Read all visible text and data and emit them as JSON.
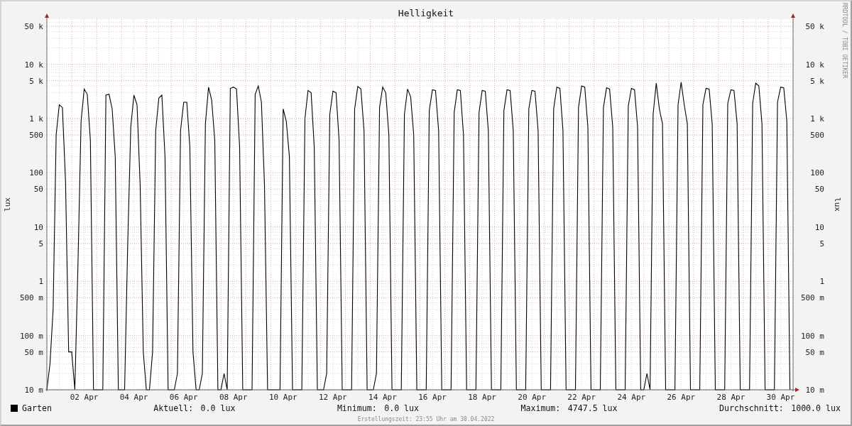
{
  "title": "Helligkeit",
  "y_axis": {
    "label": "lux",
    "ticks": [
      "50 k",
      "10 k",
      "5 k",
      "1 k",
      "500",
      "100",
      "50",
      "10",
      "5",
      "1",
      "500 m",
      "100 m",
      "50 m",
      "10 m"
    ]
  },
  "right_axis": {
    "label": "lux",
    "ticks": [
      "50 k",
      "10 k",
      "5 k",
      "1 k",
      "500",
      "100",
      "50",
      "10",
      "5",
      "1",
      "500 m",
      "100 m",
      "50 m",
      "10 m"
    ]
  },
  "x_axis": {
    "ticks": [
      "02 Apr",
      "04 Apr",
      "06 Apr",
      "08 Apr",
      "10 Apr",
      "12 Apr",
      "14 Apr",
      "16 Apr",
      "18 Apr",
      "20 Apr",
      "22 Apr",
      "24 Apr",
      "26 Apr",
      "28 Apr",
      "30 Apr"
    ]
  },
  "signature": "RRDTOOL / TOBI OETIKER",
  "legend": [
    {
      "name": "Garten",
      "color": "#000000"
    }
  ],
  "stats": [
    {
      "label": "Aktuell:",
      "value": "0.0 lux"
    },
    {
      "label": "Minimum:",
      "value": "0.0 lux"
    },
    {
      "label": "Maximum:",
      "value": "4747.5 lux"
    },
    {
      "label": "Durchschnitt:",
      "value": "1000.0 lux"
    }
  ],
  "footer": "Erstellungszeit: 23:55 Uhr am 30.04.2022"
}
